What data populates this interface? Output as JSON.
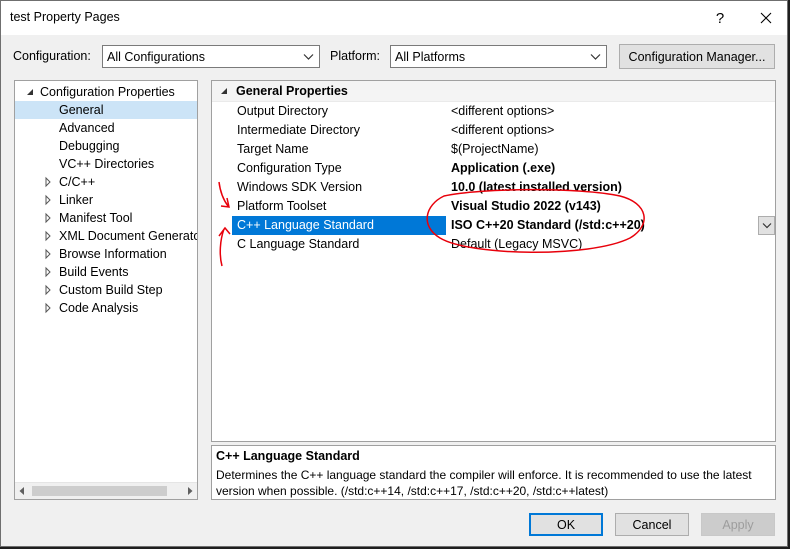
{
  "window": {
    "title": "test Property Pages",
    "help_glyph": "?"
  },
  "toolbar": {
    "configuration_label": "Configuration:",
    "configuration_value": "All Configurations",
    "platform_label": "Platform:",
    "platform_value": "All Platforms",
    "config_manager_label": "Configuration Manager..."
  },
  "tree": {
    "items": [
      {
        "label": "Configuration Properties",
        "expander": "expanded",
        "selected": false
      },
      {
        "label": "General",
        "expander": "none",
        "selected": true
      },
      {
        "label": "Advanced",
        "expander": "none",
        "selected": false
      },
      {
        "label": "Debugging",
        "expander": "none",
        "selected": false
      },
      {
        "label": "VC++ Directories",
        "expander": "none",
        "selected": false
      },
      {
        "label": "C/C++",
        "expander": "collapsed",
        "selected": false
      },
      {
        "label": "Linker",
        "expander": "collapsed",
        "selected": false
      },
      {
        "label": "Manifest Tool",
        "expander": "collapsed",
        "selected": false
      },
      {
        "label": "XML Document Generator",
        "expander": "collapsed",
        "selected": false
      },
      {
        "label": "Browse Information",
        "expander": "collapsed",
        "selected": false
      },
      {
        "label": "Build Events",
        "expander": "collapsed",
        "selected": false
      },
      {
        "label": "Custom Build Step",
        "expander": "collapsed",
        "selected": false
      },
      {
        "label": "Code Analysis",
        "expander": "collapsed",
        "selected": false
      }
    ]
  },
  "grid": {
    "section_title": "General Properties",
    "rows": [
      {
        "name": "Output Directory",
        "value": "<different options>",
        "bold": false
      },
      {
        "name": "Intermediate Directory",
        "value": "<different options>",
        "bold": false
      },
      {
        "name": "Target Name",
        "value": "$(ProjectName)",
        "bold": false
      },
      {
        "name": "Configuration Type",
        "value": "Application (.exe)",
        "bold": true
      },
      {
        "name": "Windows SDK Version",
        "value": "10.0 (latest installed version)",
        "bold": true
      },
      {
        "name": "Platform Toolset",
        "value": "Visual Studio 2022 (v143)",
        "bold": true
      },
      {
        "name": "C++ Language Standard",
        "value": "ISO C++20 Standard (/std:c++20)",
        "bold": true,
        "selected": true
      },
      {
        "name": "C Language Standard",
        "value": "Default (Legacy MSVC)",
        "bold": false
      }
    ]
  },
  "description": {
    "title": "C++ Language Standard",
    "text": "Determines the C++ language standard the compiler will enforce. It is recommended to use the latest version when possible.  (/std:c++14, /std:c++17, /std:c++20, /std:c++latest)"
  },
  "buttons": {
    "ok": "OK",
    "cancel": "Cancel",
    "apply": "Apply"
  },
  "colors": {
    "accent": "#0078d7",
    "annotation": "#e8000b"
  }
}
